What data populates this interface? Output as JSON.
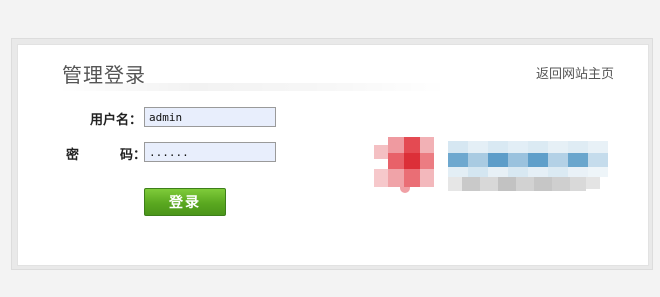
{
  "header": {
    "title": "管理登录",
    "home_link": "返回网站主页"
  },
  "form": {
    "username_label": "用户名：",
    "username_value": "admin",
    "password_label_left": "密",
    "password_label_right": "码：",
    "password_value": "......",
    "submit_label": "登录"
  },
  "colors": {
    "button_green": "#5aa820",
    "input_bg": "#e8eefc",
    "logo_red": "#e0424a",
    "logo_blue": "#5b9ec8"
  },
  "logo": {
    "description": "pixelated-logo"
  }
}
